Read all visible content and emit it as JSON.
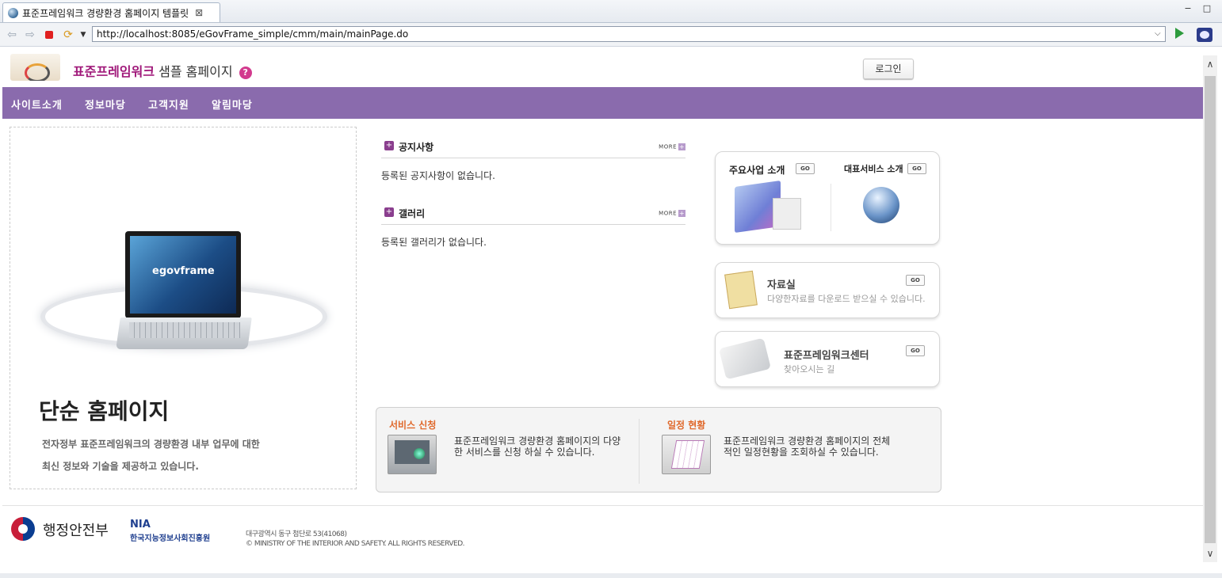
{
  "browser": {
    "tab_title": "표준프레임워크 경량환경 홈페이지 템플릿",
    "tab_close": "⊠",
    "url": "http://localhost:8085/eGovFrame_simple/cmm/main/mainPage.do"
  },
  "header": {
    "site_title_highlight": "표준프레임워크",
    "site_title_rest": " 샘플 홈페이지",
    "help_icon": "?",
    "login_label": "로그인"
  },
  "nav": {
    "items": [
      "사이트소개",
      "정보마당",
      "고객지원",
      "알림마당"
    ]
  },
  "hero": {
    "laptop_brand": "egovframe",
    "title": "단순 홈페이지",
    "desc_line1": "전자정부 표준프레임워크의 경량환경 내부 업무에 대한",
    "desc_line2": "최신 정보와 기술을 제공하고 있습니다."
  },
  "notice": {
    "title": "공지사항",
    "more": "MORE",
    "empty": "등록된 공지사항이 없습니다."
  },
  "gallery": {
    "title": "갤러리",
    "more": "MORE",
    "empty": "등록된 갤러리가 없습니다."
  },
  "cards": {
    "business": "주요사업 소개",
    "service": "대표서비스 소개",
    "go": "GO",
    "archive_title": "자료실",
    "archive_desc": "다양한자료를 다운로드 받으실 수 있습니다.",
    "center_title": "표준프레임워크센터",
    "center_desc": "찾아오시는 길"
  },
  "services": {
    "apply_title": "서비스 신청",
    "apply_desc": "표준프레임워크 경량환경 홈페이지의 다양한 서비스를 신청 하실 수 있습니다.",
    "schedule_title": "일정 현황",
    "schedule_desc": "표준프레임워크 경량환경 홈페이지의 전체적인 일정현황을 조회하실 수 있습니다."
  },
  "footer": {
    "gov_name": "행정안전부",
    "nia": "NIA",
    "nia_full": "한국지능정보사회진흥원",
    "address": "대구광역시 동구 첨단로 53(41068)",
    "copyright": "© MINISTRY OF THE INTERIOR AND SAFETY. ALL RIGHTS RESERVED."
  },
  "colors": {
    "nav_bg": "#8a6bad",
    "brand_magenta": "#a0197a",
    "service_title": "#e0692c"
  }
}
